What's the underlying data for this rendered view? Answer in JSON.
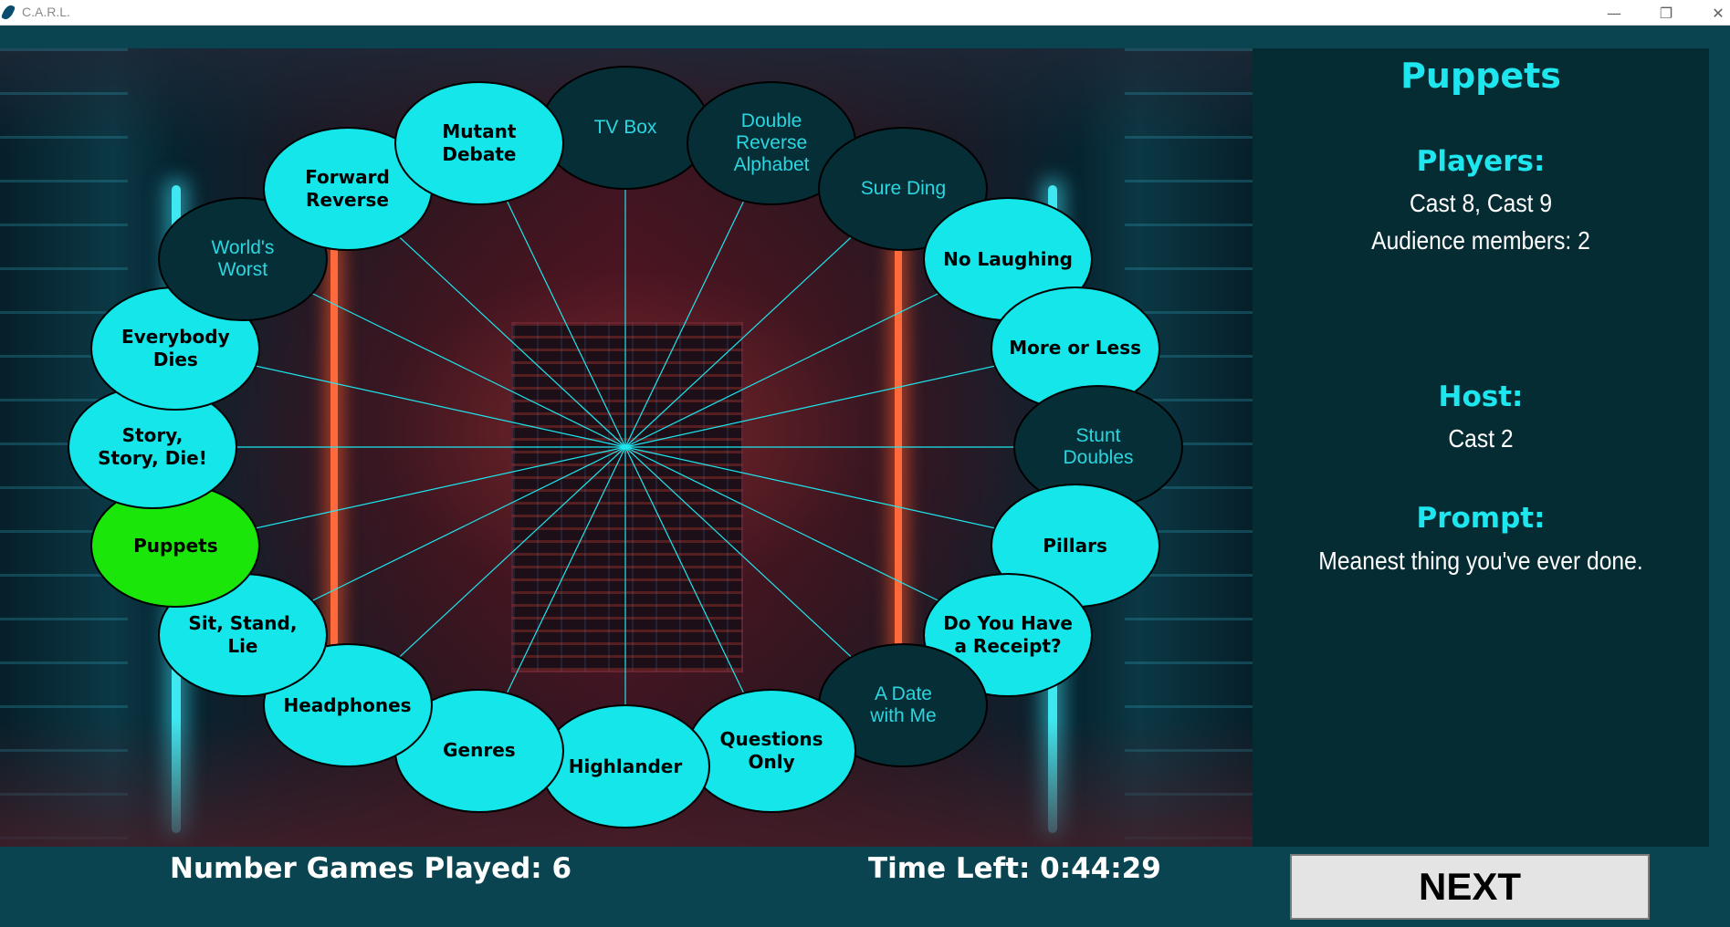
{
  "window": {
    "title": "C.A.R.L.",
    "controls": {
      "minimize": "—",
      "restore": "❐",
      "close": "✕"
    }
  },
  "games": [
    {
      "label": "TV Box",
      "state": "played"
    },
    {
      "label": "Double\nReverse\nAlphabet",
      "state": "played"
    },
    {
      "label": "Sure Ding",
      "state": "played"
    },
    {
      "label": "No Laughing",
      "state": "available"
    },
    {
      "label": "More or Less",
      "state": "available"
    },
    {
      "label": "Stunt\nDoubles",
      "state": "played"
    },
    {
      "label": "Pillars",
      "state": "available"
    },
    {
      "label": "Do You Have\na Receipt?",
      "state": "available"
    },
    {
      "label": "A Date\nwith Me",
      "state": "played"
    },
    {
      "label": "Questions\nOnly",
      "state": "available"
    },
    {
      "label": "Highlander",
      "state": "available"
    },
    {
      "label": "Genres",
      "state": "available"
    },
    {
      "label": "Headphones",
      "state": "available"
    },
    {
      "label": "Sit, Stand,\nLie",
      "state": "available"
    },
    {
      "label": "Puppets",
      "state": "selected"
    },
    {
      "label": "Story,\nStory, Die!",
      "state": "available"
    },
    {
      "label": "Everybody\nDies",
      "state": "available"
    },
    {
      "label": "World's\nWorst",
      "state": "played"
    },
    {
      "label": "Forward\nReverse",
      "state": "available"
    },
    {
      "label": "Mutant\nDebate",
      "state": "available"
    }
  ],
  "colors": {
    "available": "#14e6ea",
    "played": "#062e36",
    "selected": "#1be60a",
    "spoke": "#1ee6ee",
    "accent_text": "#1ee6ee"
  },
  "info": {
    "game_title": "Puppets",
    "players_heading": "Players:",
    "players_line1": "Cast 8, Cast 9",
    "players_line2": "Audience members: 2",
    "host_heading": "Host:",
    "host_value": "Cast 2",
    "prompt_heading": "Prompt:",
    "prompt_value": "Meanest thing you've ever done."
  },
  "status": {
    "games_played": "Number Games Played: 6",
    "time_left": "Time Left: 0:44:29"
  },
  "next_button": "NEXT"
}
